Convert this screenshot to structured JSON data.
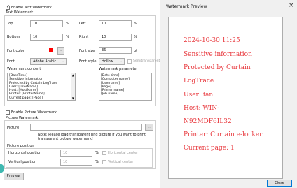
{
  "left_panel": {
    "enable_text_watermark": "Enable Text Watermark",
    "text_watermark_group": "Text Watermark",
    "top_label": "Top",
    "top_value": "10",
    "top_unit": "%",
    "left_label": "Left",
    "left_value": "10",
    "left_unit": "%",
    "bottom_label": "Bottom",
    "bottom_value": "10",
    "bottom_unit": "%",
    "right_label": "Right",
    "right_value": "10",
    "right_unit": "%",
    "font_color_label": "Font color",
    "font_color_button": "...",
    "font_color": "#ff0000",
    "font_size_label": "Font size",
    "font_size_value": "36",
    "font_size_unit": "pt",
    "font_label": "Font",
    "font_value": "Adobe Arabic",
    "font_style_label": "Font style",
    "font_style_value": "Hollow",
    "semitransparent_label": "Semitransparent",
    "watermark_content_label": "Watermark content",
    "watermark_content_lines": [
      "[DateTime]",
      "Sensitive information",
      "Protected by Curtain LogTrace",
      "User: [UserName]",
      "Host: [HostName]",
      "Printer: [PrinterName]",
      "Current page: [Page]"
    ],
    "watermark_parameter_label": "Watermark parameter",
    "watermark_parameter_lines": [
      "[Date time]",
      "[Computer name]",
      "[Username]",
      "[Page]",
      "[Printer name]",
      "[Job name]"
    ],
    "enable_picture_watermark": "Enable Picture Watermark",
    "picture_watermark_group": "Picture Watermark",
    "picture_label": "Picture",
    "picture_button": "...",
    "picture_note": "Note: Please load transparent png picture if you want to print transparent picture watermark!",
    "picture_position_group": "Picture position",
    "horizontal_position_label": "Horizontal position",
    "horizontal_value": "10",
    "horizontal_unit": "%",
    "horizontal_center_label": "Horizontal center",
    "vertical_position_label": "Vertical position",
    "vertical_value": "10",
    "vertical_unit": "%",
    "vertical_center_label": "Vertical center",
    "preview_button": "Preview"
  },
  "preview_window": {
    "title": "Watermark Preview",
    "close_icon": "×",
    "lines": [
      "2024-10-30 11:25",
      "Sensitive information",
      "Protected by Curtain",
      "LogTrace",
      "User: fan",
      "Host: WIN-",
      "N92MDF6IL32",
      "Printer: Curtain e-locker",
      "Current page: 1"
    ],
    "text_color": "#e8383d",
    "close_button": "Close"
  }
}
